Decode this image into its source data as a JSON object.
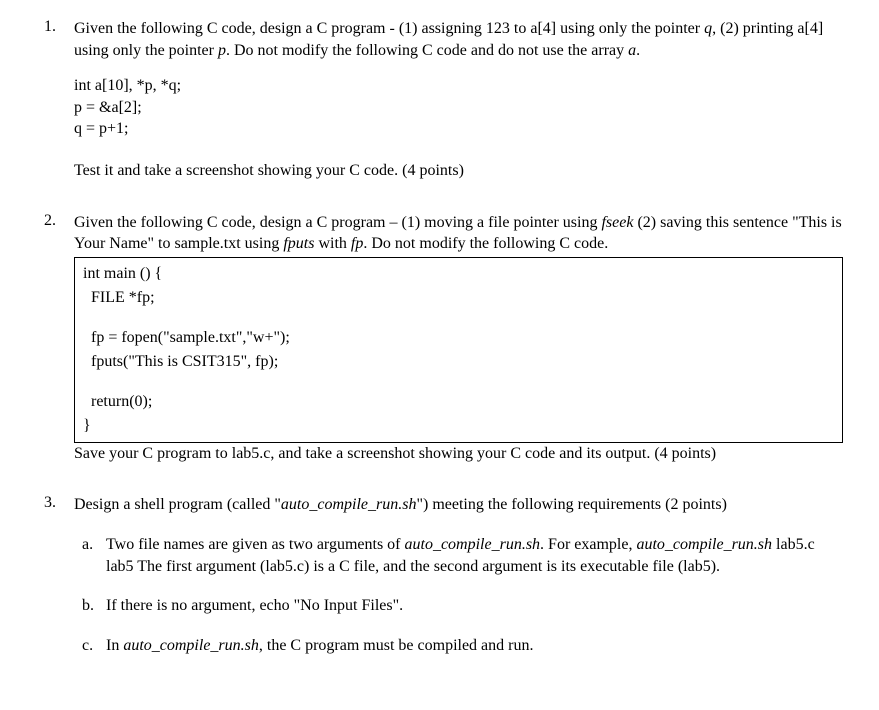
{
  "q1": {
    "intro_pre": "Given the following C code, design a C program - (1) assigning 123 to a[4] using only the pointer ",
    "intro_q": "q",
    "intro_mid": ", (2) printing a[4] using only the pointer ",
    "intro_p": "p",
    "intro_end1": ". Do not modify the following C code and do not use the array ",
    "intro_a": "a",
    "intro_end2": ".",
    "code1": "int a[10], *p, *q;",
    "code2": "p = &a[2];",
    "code3": "q = p+1;",
    "closing": "Test it and take a screenshot showing your C code. (4 points)"
  },
  "q2": {
    "intro_pre": "Given the following C code, design a C program – (1) moving a file pointer using ",
    "intro_fseek": "fseek",
    "intro_mid": " (2) saving this sentence \"This is Your Name\" to sample.txt using ",
    "intro_fputs": "fputs",
    "intro_with": " with ",
    "intro_fp": "fp",
    "intro_end": ". Do not modify the following C code.",
    "box1": "int main () {",
    "box2": "  FILE *fp;",
    "box3": "  fp = fopen(\"sample.txt\",\"w+\");",
    "box4": "  fputs(\"This is CSIT315\", fp);",
    "box5": "  return(0);",
    "box6": "}",
    "closing": "Save your C program to lab5.c, and take a screenshot showing your C code and its output. (4 points)"
  },
  "q3": {
    "intro_pre": "Design a shell program (called \"",
    "intro_script": "auto_compile_run.sh",
    "intro_end": "\") meeting the following requirements (2 points)",
    "a_pre": "Two file names are given as two arguments of ",
    "a_script": "auto_compile_run.sh",
    "a_mid": ". For example, ",
    "a_script2": "auto_compile_run.sh",
    "a_end": " lab5.c lab5 The first argument (lab5.c) is a C file, and the second argument is its executable file (lab5).",
    "b": "If there is no argument, echo \"No Input Files\".",
    "c_pre": "In ",
    "c_script": "auto_compile_run.sh",
    "c_end": ", the C program must be compiled and run."
  }
}
